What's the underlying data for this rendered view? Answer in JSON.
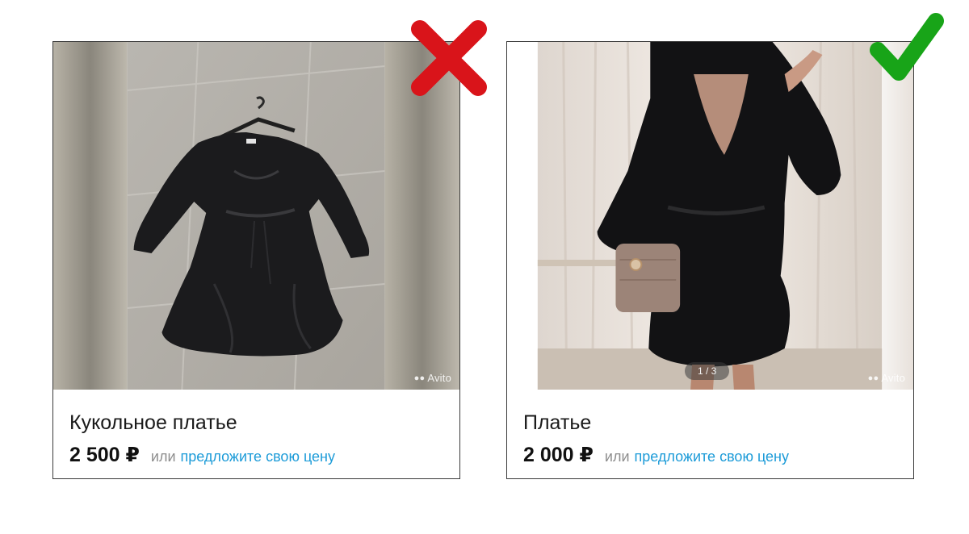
{
  "listings": [
    {
      "title": "Кукольное платье",
      "price": "2 500 ₽",
      "or_label": "или",
      "offer_link": "предложите свою цену",
      "watermark": "Avito",
      "verdict_icon": "red-cross-icon"
    },
    {
      "title": "Платье",
      "price": "2 000 ₽",
      "or_label": "или",
      "offer_link": "предложите свою цену",
      "watermark": "Avito",
      "photo_counter": "1 / 3",
      "verdict_icon": "green-check-icon"
    }
  ],
  "colors": {
    "cross": "#d9141a",
    "check": "#18a418",
    "link": "#1c9bd8",
    "border": "#3a3a3a"
  }
}
